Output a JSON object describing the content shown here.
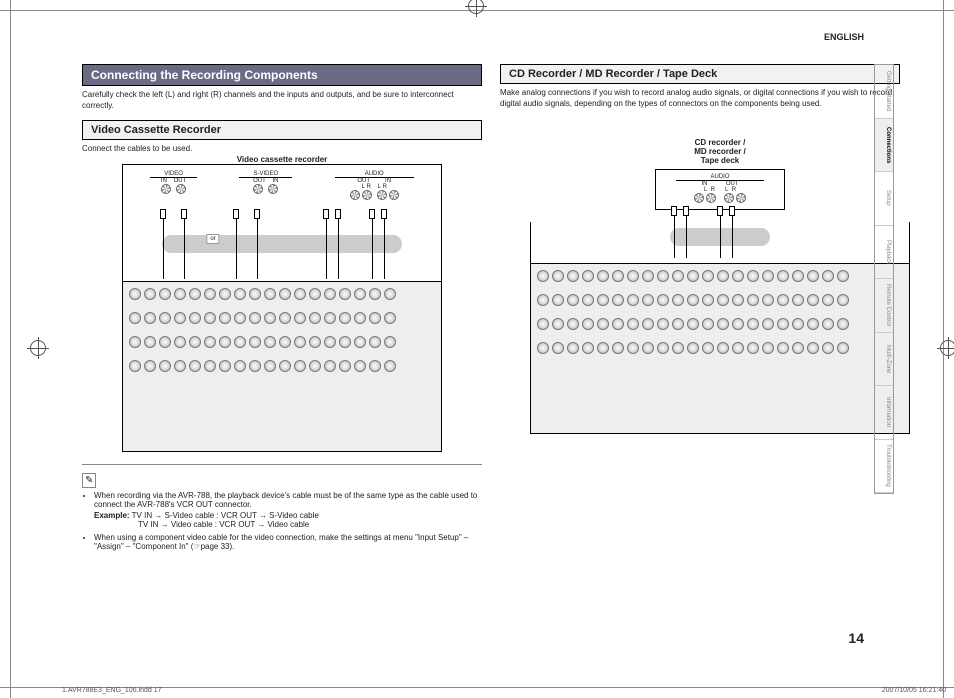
{
  "lang_label": "ENGLISH",
  "left": {
    "section_title": "Connecting the Recording Components",
    "intro": "Carefully check the left (L) and right (R) channels and the inputs and outputs, and be sure to interconnect correctly.",
    "sub_title": "Video Cassette Recorder",
    "sub_intro": "Connect the cables to be used.",
    "vcr_label": "Video cassette recorder",
    "ports": {
      "group1": "VIDEO",
      "group1_in": "IN",
      "group1_out": "OUT",
      "group2": "S-VIDEO",
      "group2_out": "OUT",
      "group2_in": "IN",
      "group3": "AUDIO",
      "group3_out": "OUT",
      "group3_in": "IN",
      "lr_l": "L",
      "lr_r": "R"
    },
    "or_label": "or",
    "notes": [
      "When recording via the AVR-788, the playback device's cable must be of the same type as the cable used to connect the AVR-788's VCR OUT connector.",
      "When using a component video cable for the video connection, make the settings at menu \"Input Setup\" – \"Assign\" – \"Component In\" (☞page 33)."
    ],
    "example": {
      "label": "Example:",
      "line1": "TV IN → S-Video cable : VCR OUT → S-Video cable",
      "line2": "TV IN → Video cable : VCR OUT → Video cable"
    }
  },
  "right": {
    "section_title": "CD Recorder / MD Recorder / Tape Deck",
    "intro": "Make analog connections if you wish to record analog audio signals, or digital connections if you wish to record digital audio signals, depending on the types of connectors on the components being used.",
    "device_label_l1": "CD recorder /",
    "device_label_l2": "MD recorder /",
    "device_label_l3": "Tape deck",
    "ports": {
      "group": "AUDIO",
      "in": "IN",
      "out": "OUT",
      "l": "L",
      "r": "R"
    }
  },
  "tabs": [
    "Getting Started",
    "Connections",
    "Setup",
    "Playback",
    "Remote Control",
    "Multi-Zone",
    "Information",
    "Troubleshooting"
  ],
  "active_tab_index": 1,
  "page_number": "14",
  "footer_left": "1.AVR788E3_ENG_106.indd   17",
  "footer_right": "2007/10/05   16:21:40"
}
